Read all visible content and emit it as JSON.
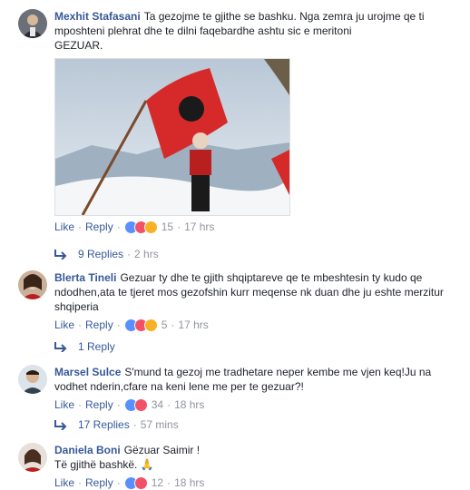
{
  "comments": [
    {
      "author": "Mexhit Stafasani",
      "text": "Ta gezojme te gjithe se bashku. Nga zemra ju urojme qe ti mposhteni plehrat dhe te dilni faqebardhe ashtu sic e meritoni\nGEZUAR.",
      "actions": {
        "like": "Like",
        "reply": "Reply",
        "count": "15",
        "time": "17 hrs"
      },
      "replies_label": "9 Replies",
      "replies_time": "2 hrs"
    },
    {
      "author": "Blerta Tineli",
      "text": "Gezuar ty dhe te gjith shqiptareve qe te mbeshtesin ty kudo qe ndodhen,ata te tjeret mos gezofshin kurr meqense nk duan dhe ju eshte merzitur shqiperia",
      "actions": {
        "like": "Like",
        "reply": "Reply",
        "count": "5",
        "time": "17 hrs"
      },
      "replies_label": "1 Reply",
      "replies_time": ""
    },
    {
      "author": "Marsel Sulce",
      "text": "S'mund ta gezoj me tradhetare neper kembe me vjen keq!Ju na vodhet nderin,cfare na keni lene me per te gezuar?!",
      "actions": {
        "like": "Like",
        "reply": "Reply",
        "count": "34",
        "time": "18 hrs"
      },
      "replies_label": "17 Replies",
      "replies_time": "57 mins"
    },
    {
      "author": "Daniela Boni",
      "text": "Gëzuar Saimir !\nTë gjithë bashkë. 🙏",
      "actions": {
        "like": "Like",
        "reply": "Reply",
        "count": "12",
        "time": "18 hrs"
      }
    }
  ],
  "colors": {
    "link": "#365899",
    "meta": "#90949c",
    "text": "#1d2129",
    "like": "#5890ff",
    "love": "#f25268",
    "haha": "#f7b125"
  }
}
